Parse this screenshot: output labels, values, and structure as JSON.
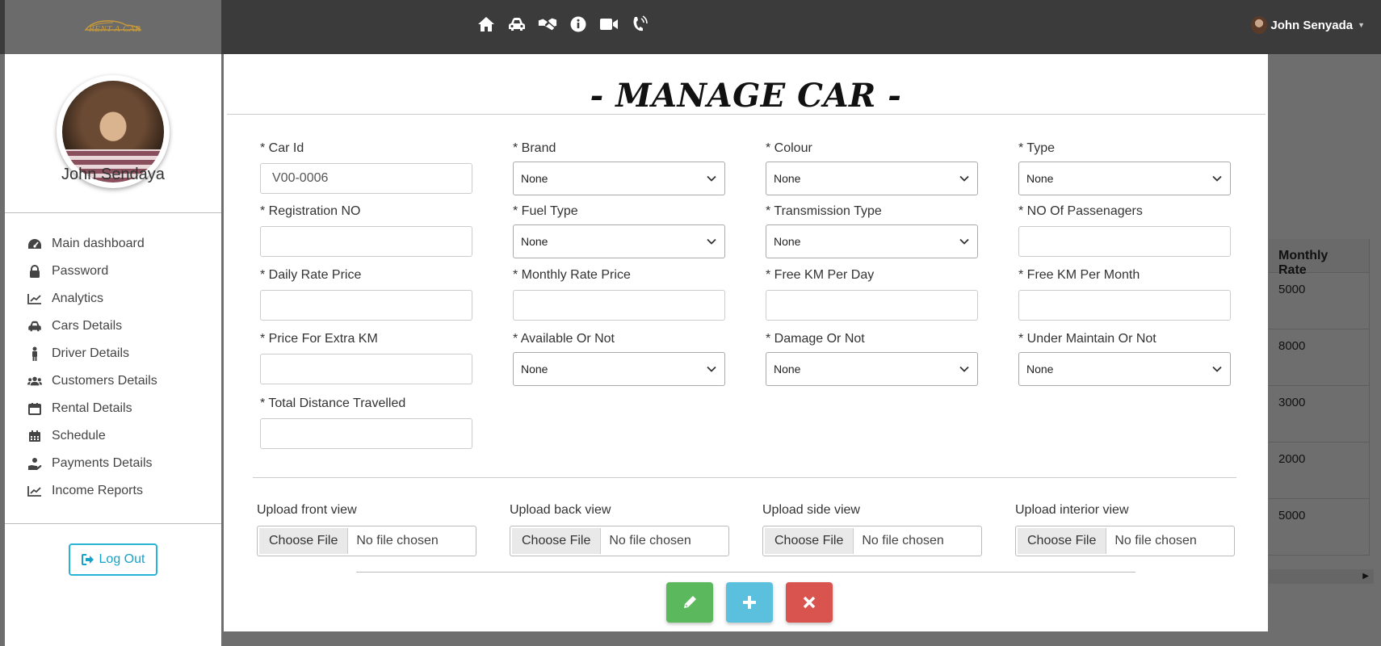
{
  "topbar": {
    "logo_text": "RENT A CAR",
    "nav_icons": [
      "home-icon",
      "car-icon",
      "handshake-icon",
      "info-icon",
      "video-icon",
      "phone-icon"
    ],
    "user_name": "John Senyada"
  },
  "sidebar": {
    "profile_name": "John Sendaya",
    "items": [
      {
        "label": "Main dashboard",
        "icon": "dashboard-icon"
      },
      {
        "label": "Password",
        "icon": "lock-icon"
      },
      {
        "label": "Analytics",
        "icon": "chart-line-icon"
      },
      {
        "label": "Cars Details",
        "icon": "car-icon"
      },
      {
        "label": "Driver Details",
        "icon": "person-icon"
      },
      {
        "label": "Customers Details",
        "icon": "users-icon"
      },
      {
        "label": "Rental Details",
        "icon": "calendar-icon"
      },
      {
        "label": "Schedule",
        "icon": "calendar-grid-icon"
      },
      {
        "label": "Payments Details",
        "icon": "hand-coin-icon"
      },
      {
        "label": "Income Reports",
        "icon": "chart-line-icon"
      }
    ],
    "logout_label": "Log Out"
  },
  "background_table": {
    "header": "Monthly Rate",
    "values": [
      "5000",
      "8000",
      "3000",
      "2000",
      "5000"
    ]
  },
  "modal": {
    "title": "- MANAGE CAR -",
    "fields": {
      "car_id": {
        "label": "* Car Id",
        "value": "V00-0006"
      },
      "brand": {
        "label": "* Brand",
        "value": "None"
      },
      "colour": {
        "label": "* Colour",
        "value": "None"
      },
      "type": {
        "label": "* Type",
        "value": "None"
      },
      "registration_no": {
        "label": "* Registration NO",
        "value": ""
      },
      "fuel_type": {
        "label": "* Fuel Type",
        "value": "None"
      },
      "transmission_type": {
        "label": "* Transmission Type",
        "value": "None"
      },
      "no_of_passengers": {
        "label": "* NO Of Passenagers",
        "value": ""
      },
      "daily_rate_price": {
        "label": "* Daily Rate Price",
        "value": ""
      },
      "monthly_rate_price": {
        "label": "* Monthly Rate Price",
        "value": ""
      },
      "free_km_per_day": {
        "label": "* Free KM Per Day",
        "value": ""
      },
      "free_km_per_month": {
        "label": "* Free KM Per Month",
        "value": ""
      },
      "price_for_extra_km": {
        "label": "* Price For Extra KM",
        "value": ""
      },
      "available_or_not": {
        "label": "* Available Or Not",
        "value": "None"
      },
      "damage_or_not": {
        "label": "* Damage Or Not",
        "value": "None"
      },
      "under_maintain_or_not": {
        "label": "* Under Maintain Or Not",
        "value": "None"
      },
      "total_distance_travelled": {
        "label": "* Total Distance Travelled",
        "value": ""
      }
    },
    "uploads": [
      {
        "label": "Upload front view",
        "button": "Choose File",
        "status": "No file chosen"
      },
      {
        "label": "Upload back view",
        "button": "Choose File",
        "status": "No file chosen"
      },
      {
        "label": "Upload side view",
        "button": "Choose File",
        "status": "No file chosen"
      },
      {
        "label": "Upload interior view",
        "button": "Choose File",
        "status": "No file chosen"
      }
    ],
    "colors": {
      "edit": "#5cb85c",
      "add": "#5bc0de",
      "close": "#d9534f"
    }
  }
}
